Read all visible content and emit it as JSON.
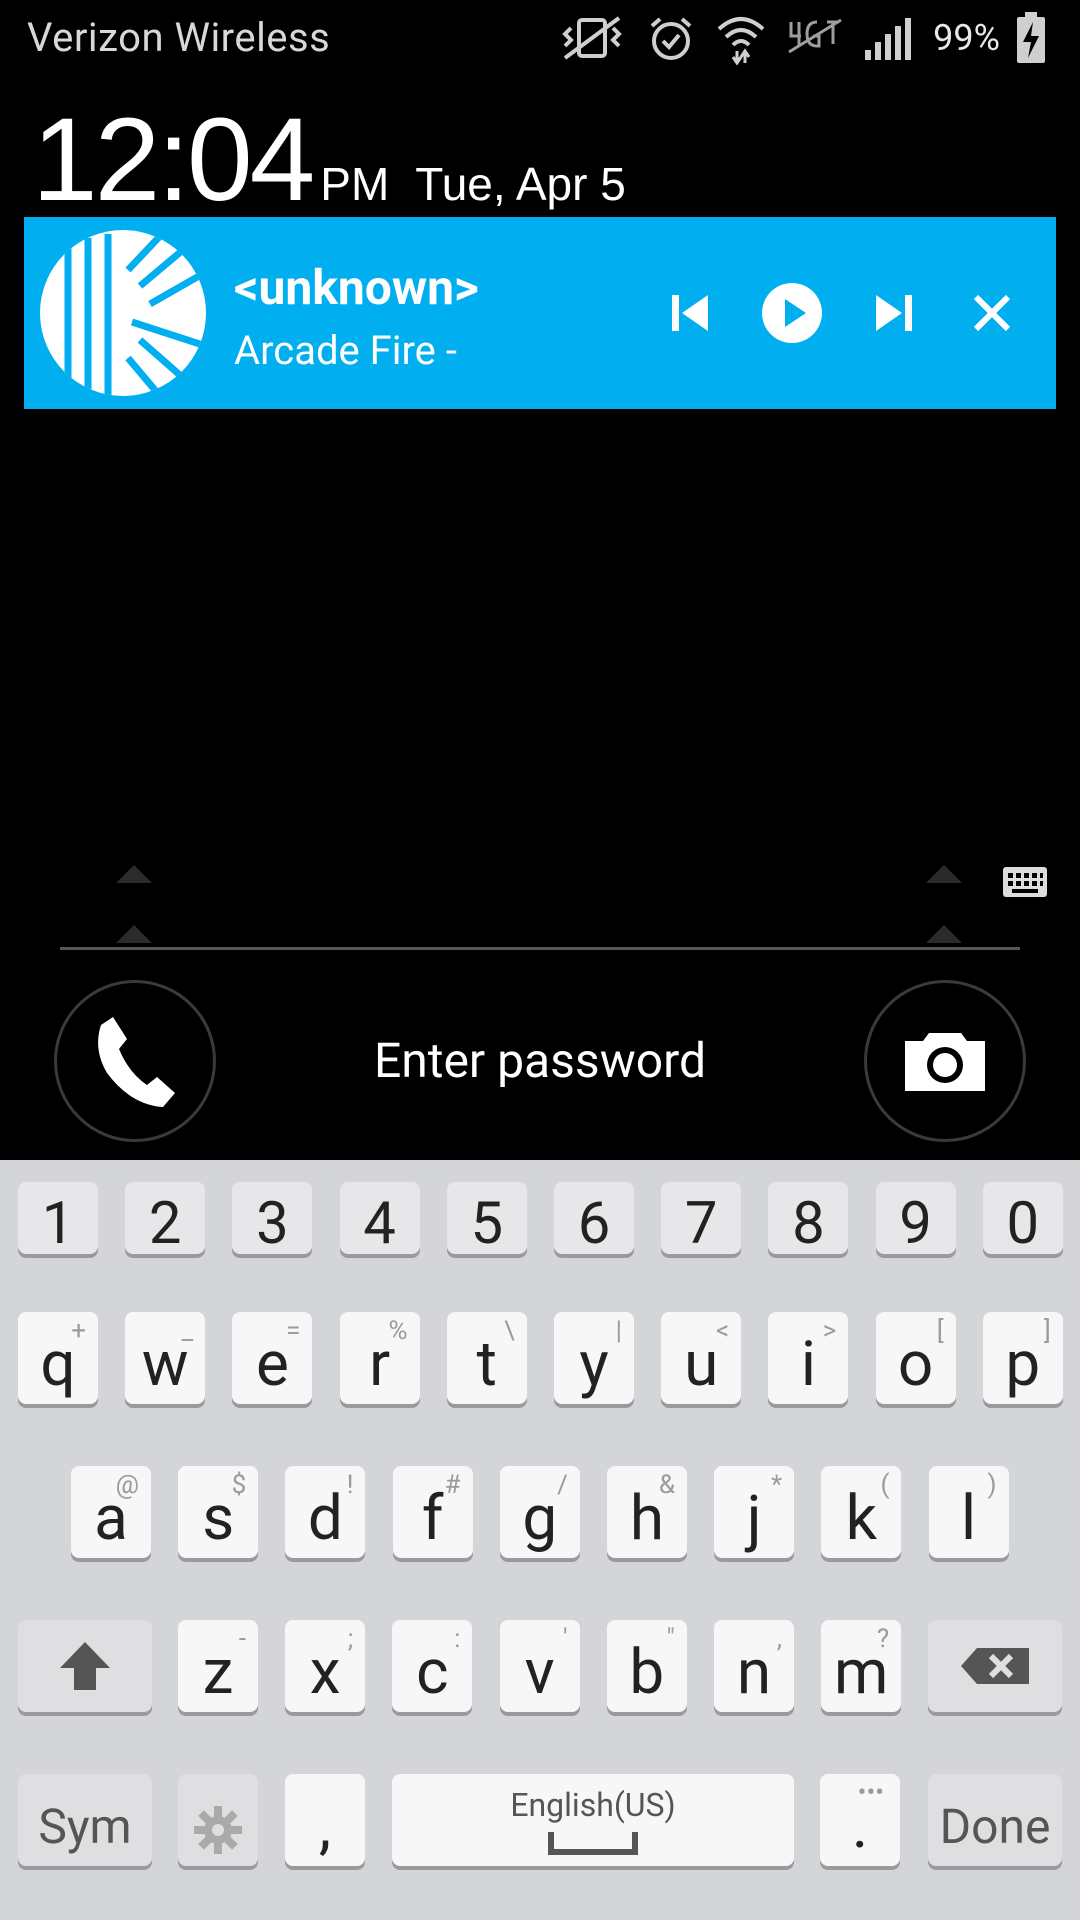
{
  "status_bar": {
    "carrier": "Verizon Wireless",
    "battery_percent": "99%",
    "icons": [
      "vibrate-icon",
      "alarm-icon",
      "wifi-icon",
      "lte-icon",
      "signal-icon",
      "battery-charging-icon"
    ]
  },
  "clock": {
    "time": "12:04",
    "ampm": "PM",
    "date": "Tue, Apr 5"
  },
  "media_notification": {
    "title": "<unknown>",
    "artist": "Arcade Fire -",
    "background_color": "#01aeef",
    "controls": [
      "previous-icon",
      "play-icon",
      "next-icon",
      "close-icon"
    ]
  },
  "lock": {
    "prompt": "Enter password",
    "left_shortcut": "phone-icon",
    "right_shortcut": "camera-icon"
  },
  "keyboard": {
    "number_row": [
      "1",
      "2",
      "3",
      "4",
      "5",
      "6",
      "7",
      "8",
      "9",
      "0"
    ],
    "row1": [
      {
        "key": "q",
        "sub": "+"
      },
      {
        "key": "w",
        "sub": "_"
      },
      {
        "key": "e",
        "sub": "="
      },
      {
        "key": "r",
        "sub": "%"
      },
      {
        "key": "t",
        "sub": "\\"
      },
      {
        "key": "y",
        "sub": "|"
      },
      {
        "key": "u",
        "sub": "<"
      },
      {
        "key": "i",
        "sub": ">"
      },
      {
        "key": "o",
        "sub": "["
      },
      {
        "key": "p",
        "sub": "]"
      }
    ],
    "row2": [
      {
        "key": "a",
        "sub": "@"
      },
      {
        "key": "s",
        "sub": "$"
      },
      {
        "key": "d",
        "sub": "!"
      },
      {
        "key": "f",
        "sub": "#"
      },
      {
        "key": "g",
        "sub": "/"
      },
      {
        "key": "h",
        "sub": "&"
      },
      {
        "key": "j",
        "sub": "*"
      },
      {
        "key": "k",
        "sub": "("
      },
      {
        "key": "l",
        "sub": ")"
      }
    ],
    "row3": [
      {
        "key": "z",
        "sub": "-"
      },
      {
        "key": "x",
        "sub": ";"
      },
      {
        "key": "c",
        "sub": ":"
      },
      {
        "key": "v",
        "sub": "'"
      },
      {
        "key": "b",
        "sub": "\""
      },
      {
        "key": "n",
        "sub": ","
      },
      {
        "key": "m",
        "sub": "?"
      }
    ],
    "sym_label": "Sym",
    "comma": ",",
    "space_label": "English(US)",
    "period": ".",
    "period_sub": "•••",
    "done_label": "Done"
  }
}
